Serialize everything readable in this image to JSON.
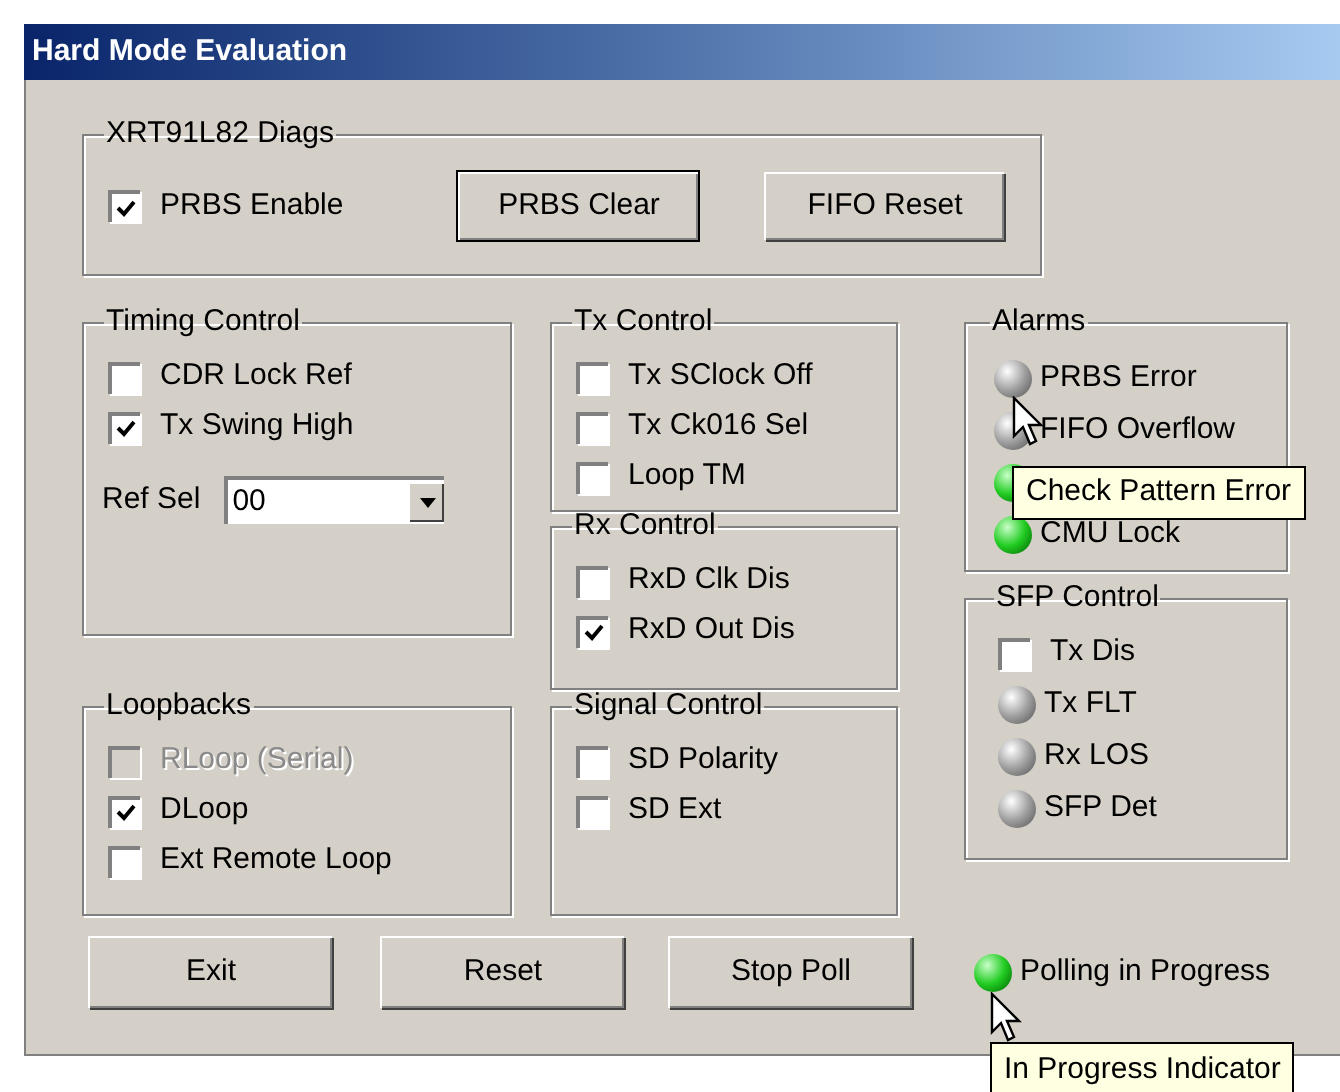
{
  "window": {
    "title": "Hard Mode Evaluation"
  },
  "diags": {
    "legend": "XRT91L82 Diags",
    "checkbox": {
      "label": "PRBS Enable",
      "checked": true
    },
    "buttons": [
      {
        "label": "PRBS Clear",
        "focused": true
      },
      {
        "label": "FIFO Reset",
        "focused": false
      }
    ]
  },
  "timing_control": {
    "legend": "Timing Control",
    "checkboxes": [
      {
        "label": "CDR Lock Ref",
        "checked": false,
        "disabled": false
      },
      {
        "label": "Tx Swing High",
        "checked": true,
        "disabled": false
      }
    ],
    "ref_sel": {
      "label": "Ref Sel",
      "value": "00"
    }
  },
  "tx_control": {
    "legend": "Tx Control",
    "checkboxes": [
      {
        "label": "Tx SClock Off",
        "checked": false,
        "disabled": false
      },
      {
        "label": "Tx Ck016 Sel",
        "checked": false,
        "disabled": false
      },
      {
        "label": "Loop TM",
        "checked": false,
        "disabled": false
      }
    ]
  },
  "rx_control": {
    "legend": "Rx Control",
    "checkboxes": [
      {
        "label": "RxD Clk Dis",
        "checked": false,
        "disabled": false
      },
      {
        "label": "RxD Out Dis",
        "checked": true,
        "disabled": false
      }
    ]
  },
  "loopbacks": {
    "legend": "Loopbacks",
    "checkboxes": [
      {
        "label": "RLoop (Serial)",
        "checked": false,
        "disabled": true
      },
      {
        "label": "DLoop",
        "checked": true,
        "disabled": false
      },
      {
        "label": "Ext Remote Loop",
        "checked": false,
        "disabled": false
      }
    ]
  },
  "signal_control": {
    "legend": "Signal Control",
    "checkboxes": [
      {
        "label": "SD Polarity",
        "checked": false,
        "disabled": false
      },
      {
        "label": "SD Ext",
        "checked": false,
        "disabled": false
      }
    ]
  },
  "alarms": {
    "legend": "Alarms",
    "indicators": [
      {
        "label": "PRBS Error",
        "on": false
      },
      {
        "label": "FIFO Overflow",
        "on": false
      },
      {
        "on": true
      },
      {
        "label": "CMU Lock",
        "on": true
      }
    ]
  },
  "sfp_control": {
    "legend": "SFP Control",
    "items": [
      {
        "kind": "checkbox",
        "label": "Tx Dis",
        "checked": false
      },
      {
        "kind": "led",
        "label": "Tx FLT",
        "on": false
      },
      {
        "kind": "led",
        "label": "Rx LOS",
        "on": false
      },
      {
        "kind": "led",
        "label": "SFP Det",
        "on": false
      }
    ]
  },
  "buttons": [
    {
      "label": "Exit"
    },
    {
      "label": "Reset"
    },
    {
      "label": "Stop Poll"
    }
  ],
  "polling": {
    "label": "Polling in Progress",
    "on": true
  },
  "tooltips": [
    {
      "text": "Check Pattern Error"
    },
    {
      "text": "In Progress Indicator"
    }
  ]
}
